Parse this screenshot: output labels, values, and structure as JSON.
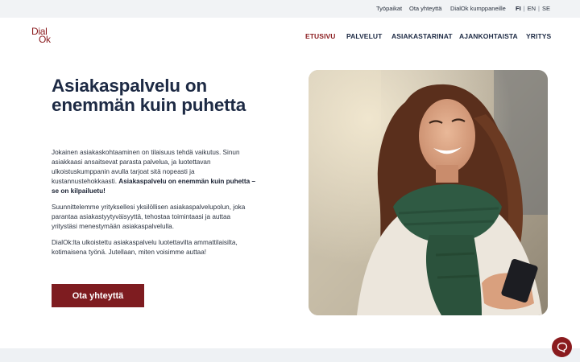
{
  "topbar": {
    "links": [
      "Työpaikat",
      "Ota yhteyttä",
      "DialOk kumppaneille"
    ],
    "languages": [
      "FI",
      "EN",
      "SE"
    ],
    "active_language": "FI"
  },
  "logo": {
    "line1": "Dial",
    "line2": "Ok"
  },
  "nav": {
    "items": [
      "ETUSIVU",
      "PALVELUT",
      "ASIAKASTARINAT",
      "AJANKOHTAISTA",
      "YRITYS"
    ],
    "active": "ETUSIVU"
  },
  "hero": {
    "title": "Asiakaspalvelu on enemmän kuin puhetta",
    "p1_text": "Jokainen asiakaskohtaaminen on tilaisuus tehdä vaikutus. Sinun asiakkaasi ansaitsevat parasta palvelua, ja luotettavan ulkoistuskumppanin avulla tarjoat sitä nopeasti ja kustannustehokkaasti. ",
    "p1_bold": "Asiakaspalvelu on enemmän kuin puhetta – se on kilpailuetu!",
    "p2": "Suunnittelemme yrityksellesi yksilöllisen asiakaspalvelupolun, joka parantaa asiakastyytyväisyyttä, tehostaa toimintaasi ja auttaa yritystäsi menestymään asiakaspalvelulla.",
    "p3": "DialOk:lta ulkoistettu asiakaspalvelu luotettavilta ammattilaisilta, kotimaisena työnä. Jutellaan, miten voisimme auttaa!",
    "cta_label": "Ota yhteyttä"
  },
  "colors": {
    "brand": "#8a1b1e",
    "navy": "#1d2a44"
  },
  "icons": {
    "chat": "chat-bubble-icon"
  }
}
